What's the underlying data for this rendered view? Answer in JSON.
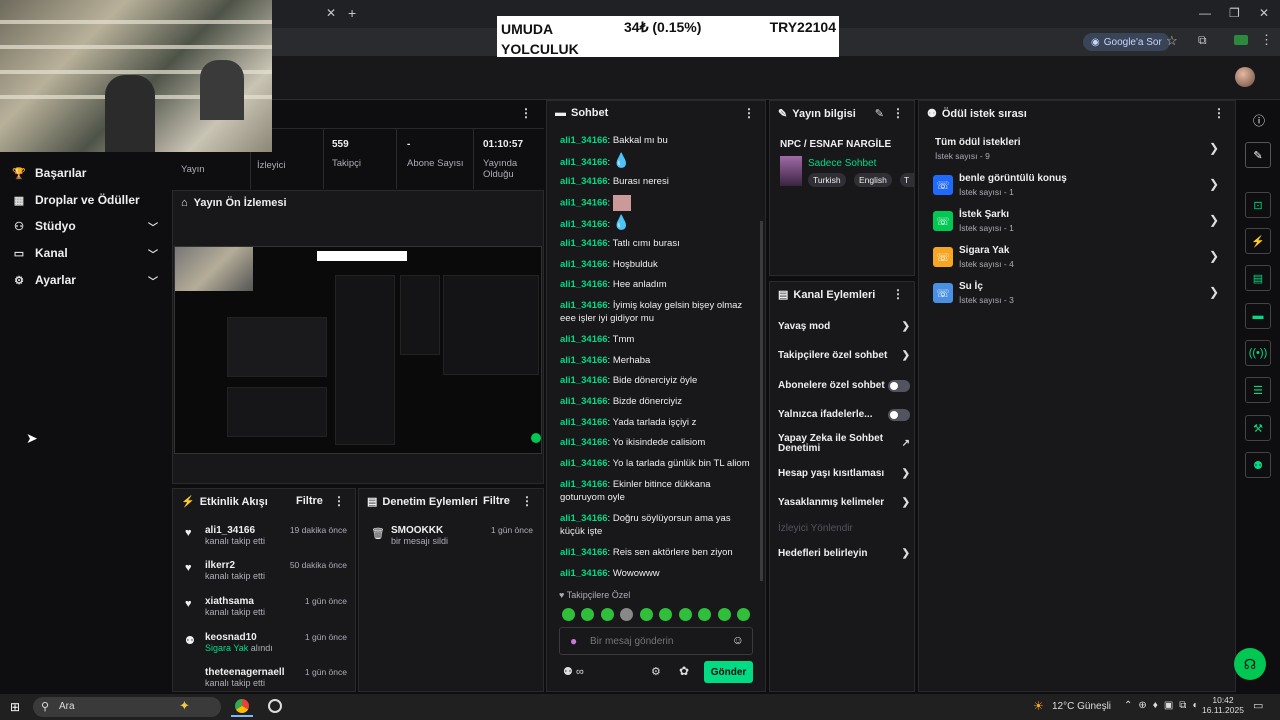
{
  "ticker": {
    "left_text": "UMUDA YOLCULUK",
    "amount": "34₺ (0.15%)",
    "target": "TRY22104"
  },
  "browser": {
    "google_btn": "Google'a Sor"
  },
  "stats": [
    {
      "value": "",
      "label": "Yayın"
    },
    {
      "value": "",
      "label": "İzleyici"
    },
    {
      "value": "559",
      "label": "Takipçi"
    },
    {
      "value": "-",
      "label": "Abone Sayısı"
    },
    {
      "value": "01:10:57",
      "label": "Yayında Olduğu"
    }
  ],
  "sidebar": {
    "items": [
      {
        "label": "Başarılar",
        "icon": "trophy-icon",
        "chevron": false
      },
      {
        "label": "Droplar ve Ödüller",
        "icon": "gift-icon",
        "chevron": false
      },
      {
        "label": "Stüdyo",
        "icon": "studio-icon",
        "chevron": true
      },
      {
        "label": "Kanal",
        "icon": "channel-icon",
        "chevron": true
      },
      {
        "label": "Ayarlar",
        "icon": "gear-icon",
        "chevron": true
      }
    ]
  },
  "preview": {
    "title": "Yayın Ön İzlemesi"
  },
  "activity": {
    "title": "Etkinlik Akışı",
    "filter": "Filtre",
    "items": [
      {
        "user": "ali1_34166",
        "time": "19 dakika önce",
        "sub": "kanalı takip etti",
        "icon": "heart-icon"
      },
      {
        "user": "ilkerr2",
        "time": "50 dakika önce",
        "sub": "kanalı takip etti",
        "icon": "heart-icon"
      },
      {
        "user": "xiathsama",
        "time": "1 gün önce",
        "sub": "kanalı takip etti",
        "icon": "heart-icon"
      },
      {
        "user": "keosnad10",
        "time": "1 gün önce",
        "sub_green": "Sigara Yak",
        "sub": "alındı",
        "icon": "points-icon"
      },
      {
        "user": "theteenagernaell",
        "time": "1 gün önce",
        "sub": "kanalı takip etti",
        "icon": "heart-icon"
      }
    ]
  },
  "moderation": {
    "title": "Denetim Eylemleri",
    "filter": "Filtre",
    "items": [
      {
        "user": "SMOOKKK",
        "time": "1 gün önce",
        "sub": "bir mesajı sildi"
      }
    ]
  },
  "chat": {
    "title": "Sohbet",
    "messages": [
      {
        "user": "ali1_34166",
        "text": "Bakkal mı bu"
      },
      {
        "user": "ali1_34166",
        "text": "",
        "emote": "drop"
      },
      {
        "user": "ali1_34166",
        "text": "Burası neresi"
      },
      {
        "user": "ali1_34166",
        "text": "",
        "emote": "face"
      },
      {
        "user": "ali1_34166",
        "text": "",
        "emote": "drop"
      },
      {
        "user": "ali1_34166",
        "text": "Tatlı cımı burası"
      },
      {
        "user": "ali1_34166",
        "text": "Hoşbulduk"
      },
      {
        "user": "ali1_34166",
        "text": "Hee anladım"
      },
      {
        "user": "ali1_34166",
        "text": "İyimiş kolay gelsin bişey olmaz eee işler iyi gidiyor mu"
      },
      {
        "user": "ali1_34166",
        "text": "Tmm"
      },
      {
        "user": "ali1_34166",
        "text": "Merhaba"
      },
      {
        "user": "ali1_34166",
        "text": "Bide dönerciyiz öyle"
      },
      {
        "user": "ali1_34166",
        "text": "Bizde dönerciyiz"
      },
      {
        "user": "ali1_34166",
        "text": "Yada tarlada işçiyi z"
      },
      {
        "user": "ali1_34166",
        "text": "Yo ikisindede calisiom"
      },
      {
        "user": "ali1_34166",
        "text": "Yo la tarlada günlük bin TL aliom"
      },
      {
        "user": "ali1_34166",
        "text": "Ekinler bitince dükkana goturuyom oyle"
      },
      {
        "user": "ali1_34166",
        "text": "Doğru söylüyorsun ama yas küçük işte"
      },
      {
        "user": "ali1_34166",
        "text": "Reis sen aktörlere ben ziyon"
      },
      {
        "user": "ali1_34166",
        "text": "Wowowww"
      }
    ],
    "followers_only": "Takipçilere Özel",
    "placeholder": "Bir mesaj gönderin",
    "send": "Gönder",
    "points": "∞"
  },
  "stream_info": {
    "title": "Yayın bilgisi",
    "name": "NPC / ESNAF NARGİLE",
    "category": "Sadece Sohbet",
    "tags": [
      "Turkish",
      "English",
      "T"
    ]
  },
  "channel_actions": {
    "title": "Kanal Eylemleri",
    "items": [
      {
        "label": "Yavaş mod",
        "kind": "arrow"
      },
      {
        "label": "Takipçilere özel sohbet",
        "kind": "arrow"
      },
      {
        "label": "Abonelere özel sohbet",
        "kind": "toggle"
      },
      {
        "label": "Yalnızca ifadelerle...",
        "kind": "toggle"
      },
      {
        "label": "Yapay Zeka ile Sohbet Denetimi",
        "kind": "external"
      },
      {
        "label": "Hesap yaşı kısıtlaması",
        "kind": "arrow"
      },
      {
        "label": "Yasaklanmış kelimeler",
        "kind": "arrow"
      },
      {
        "label": "İzleyici Yönlendir",
        "kind": "disabled"
      },
      {
        "label": "Hedefleri belirleyin",
        "kind": "arrow"
      }
    ]
  },
  "rewards": {
    "title": "Ödül istek sırası",
    "all": {
      "label": "Tüm ödül istekleri",
      "sub": "İstek sayısı - 9"
    },
    "items": [
      {
        "label": "benle görüntülü konuş",
        "sub": "İstek sayısı - 1",
        "color": "#1f69ff"
      },
      {
        "label": "İstek Şarkı",
        "sub": "İstek sayısı - 1",
        "color": "#00c853"
      },
      {
        "label": "Sigara Yak",
        "sub": "İstek sayısı - 4",
        "color": "#f5a623"
      },
      {
        "label": "Su İç",
        "sub": "İstek sayısı - 3",
        "color": "#4a90e2"
      }
    ]
  },
  "taskbar": {
    "search": "Ara",
    "weather": "12°C Güneşli",
    "time": "10:42",
    "date": "16.11.2025"
  },
  "colors": {
    "accent": "#00db84",
    "bg": "#0e0e10",
    "panel": "#18181b"
  }
}
